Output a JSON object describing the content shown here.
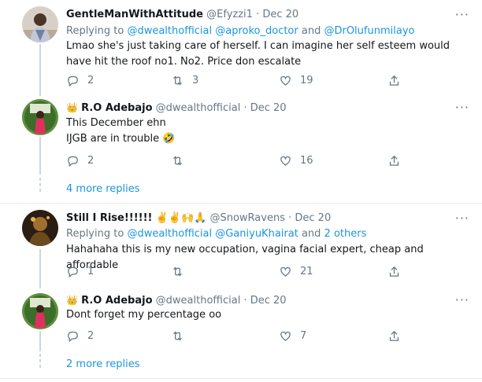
{
  "tweets": [
    {
      "name": "GentleManWithAttitude",
      "handle": "@Efyzzi1",
      "dot": "·",
      "date": "Dec 20",
      "reply_prefix": "Replying to ",
      "reply_handles": [
        "@dwealthofficial",
        "@aproko_doctor",
        "@DrOlufunmilayo"
      ],
      "reply_sep_1": " ",
      "reply_sep_2": " and ",
      "text": "Lmao she's just taking care of herself. I can imagine her self esteem would have hit the roof no1. No2. Price don escalate",
      "replies": "2",
      "retweets": "3",
      "likes": "19"
    },
    {
      "name_prefix": "👑",
      "name": "R.O Adebajo",
      "handle": "@dwealthofficial",
      "dot": "·",
      "date": "Dec 20",
      "text_line1": "This December ehn",
      "text_line2": "IJGB are in trouble 🤣",
      "replies": "2",
      "retweets": "",
      "likes": "16"
    },
    {
      "name": "Still I Rise!!!!!!",
      "name_emoji": "✌️✌️🙌🙏",
      "handle": "@SnowRavens",
      "dot": "·",
      "date": "Dec 20",
      "reply_prefix": "Replying to ",
      "reply_handles": [
        "@dwealthofficial",
        "@GaniyuKhairat"
      ],
      "reply_sep_2": " and ",
      "reply_others": "2 others",
      "text": "Hahahaha this is my new occupation, vagina facial expert, cheap and affordable",
      "replies": "1",
      "retweets": "",
      "likes": "21"
    },
    {
      "name_prefix": "👑",
      "name": "R.O Adebajo",
      "handle": "@dwealthofficial",
      "dot": "·",
      "date": "Dec 20",
      "text": "Dont forget my percentage oo",
      "replies": "2",
      "retweets": "",
      "likes": "7"
    }
  ],
  "show_more_1": "4 more replies",
  "show_more_2": "2 more replies",
  "more_icon": "···",
  "colors": {
    "link": "#1b95e0",
    "muted": "#657786",
    "line": "#ccd6dd"
  }
}
